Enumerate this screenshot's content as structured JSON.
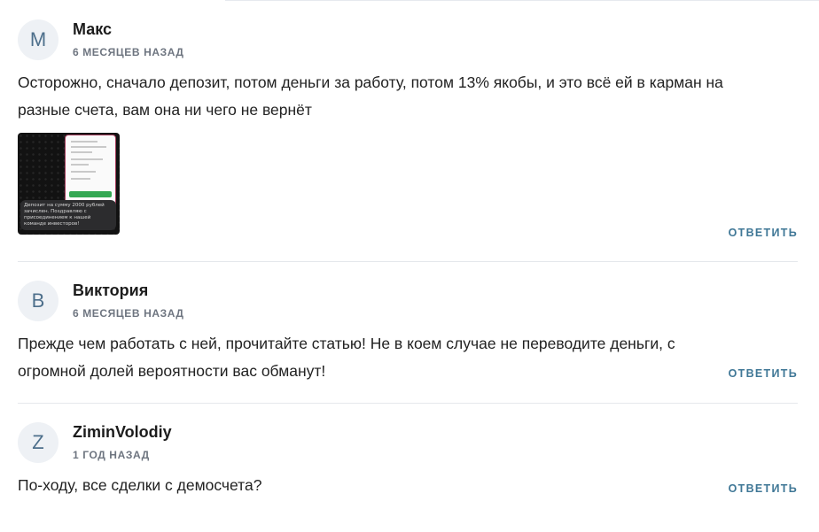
{
  "comments": [
    {
      "avatar_letter": "М",
      "author": "Макс",
      "date": "6 МЕСЯЦЕВ НАЗАД",
      "text": "Осторожно, сначало депозит, потом деньги за работу, потом 13% якобы, и это всё ей в карман на разные счета, вам она ни чего не вернёт",
      "attachment_caption": "Депозит на сумму 2000 рублей зачислен. Поздравляю с присоединением к нашей команде инвесторов!",
      "reply_label": "ОТВЕТИТЬ"
    },
    {
      "avatar_letter": "В",
      "author": "Виктория",
      "date": "6 МЕСЯЦЕВ НАЗАД",
      "text": "Прежде чем работать с ней, прочитайте статью! Не в коем случае не переводите деньги, с огромной долей вероятности вас обманут!",
      "reply_label": "ОТВЕТИТЬ"
    },
    {
      "avatar_letter": "Z",
      "author": "ZiminVolodiy",
      "date": "1 ГОД НАЗАД",
      "text": "По-ходу, все сделки с демосчета?",
      "reply_label": "ОТВЕТИТЬ"
    }
  ]
}
